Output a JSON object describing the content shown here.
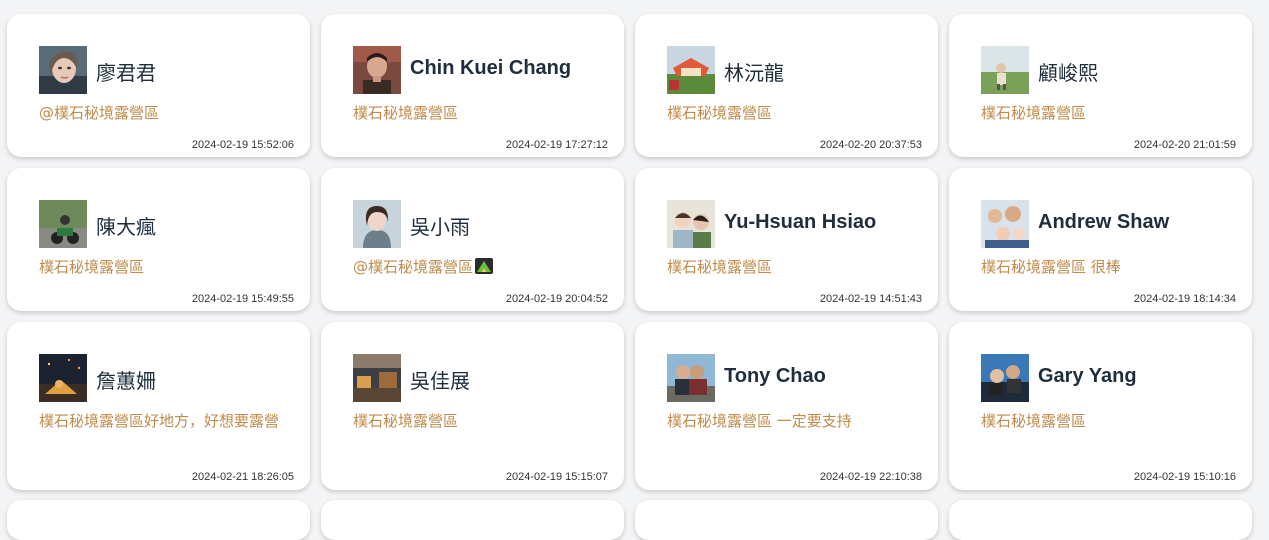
{
  "cards": [
    {
      "name": "廖君君",
      "comment": "@樸石秘境露營區",
      "time": "2024-02-19 15:52:06"
    },
    {
      "name": "Chin Kuei Chang",
      "comment": "樸石秘境露營區",
      "time": "2024-02-19 17:27:12"
    },
    {
      "name": "林沅龍",
      "comment": "樸石秘境露營區",
      "time": "2024-02-20 20:37:53"
    },
    {
      "name": "顧峻熙",
      "comment": "樸石秘境露營區",
      "time": "2024-02-20 21:01:59"
    },
    {
      "name": "陳大瘋",
      "comment": "樸石秘境露營區",
      "time": "2024-02-19 15:49:55"
    },
    {
      "name": "吳小雨",
      "comment": "@樸石秘境露營區",
      "time": "2024-02-19 20:04:52"
    },
    {
      "name": "Yu-Hsuan Hsiao",
      "comment": "樸石秘境露營區",
      "time": "2024-02-19 14:51:43"
    },
    {
      "name": "Andrew Shaw",
      "comment": "樸石秘境露營區 很棒",
      "time": "2024-02-19 18:14:34"
    },
    {
      "name": "詹蕙姍",
      "comment": "樸石秘境露營區好地方，好想要露營",
      "time": "2024-02-21 18:26:05"
    },
    {
      "name": "吳佳展",
      "comment": "樸石秘境露營區",
      "time": "2024-02-19 15:15:07"
    },
    {
      "name": "Tony Chao",
      "comment": "樸石秘境露營區 一定要支持",
      "time": "2024-02-19 22:10:38"
    },
    {
      "name": "Gary Yang",
      "comment": "樸石秘境露營區",
      "time": "2024-02-19 15:10:16"
    }
  ],
  "colors": {
    "name": "#1f2d3d",
    "comment": "#c08a4a",
    "timestamp": "#333333",
    "card_bg": "#ffffff",
    "page_bg": "#f3f4f6"
  },
  "icons": {
    "camping_emoji": "camping-icon"
  }
}
